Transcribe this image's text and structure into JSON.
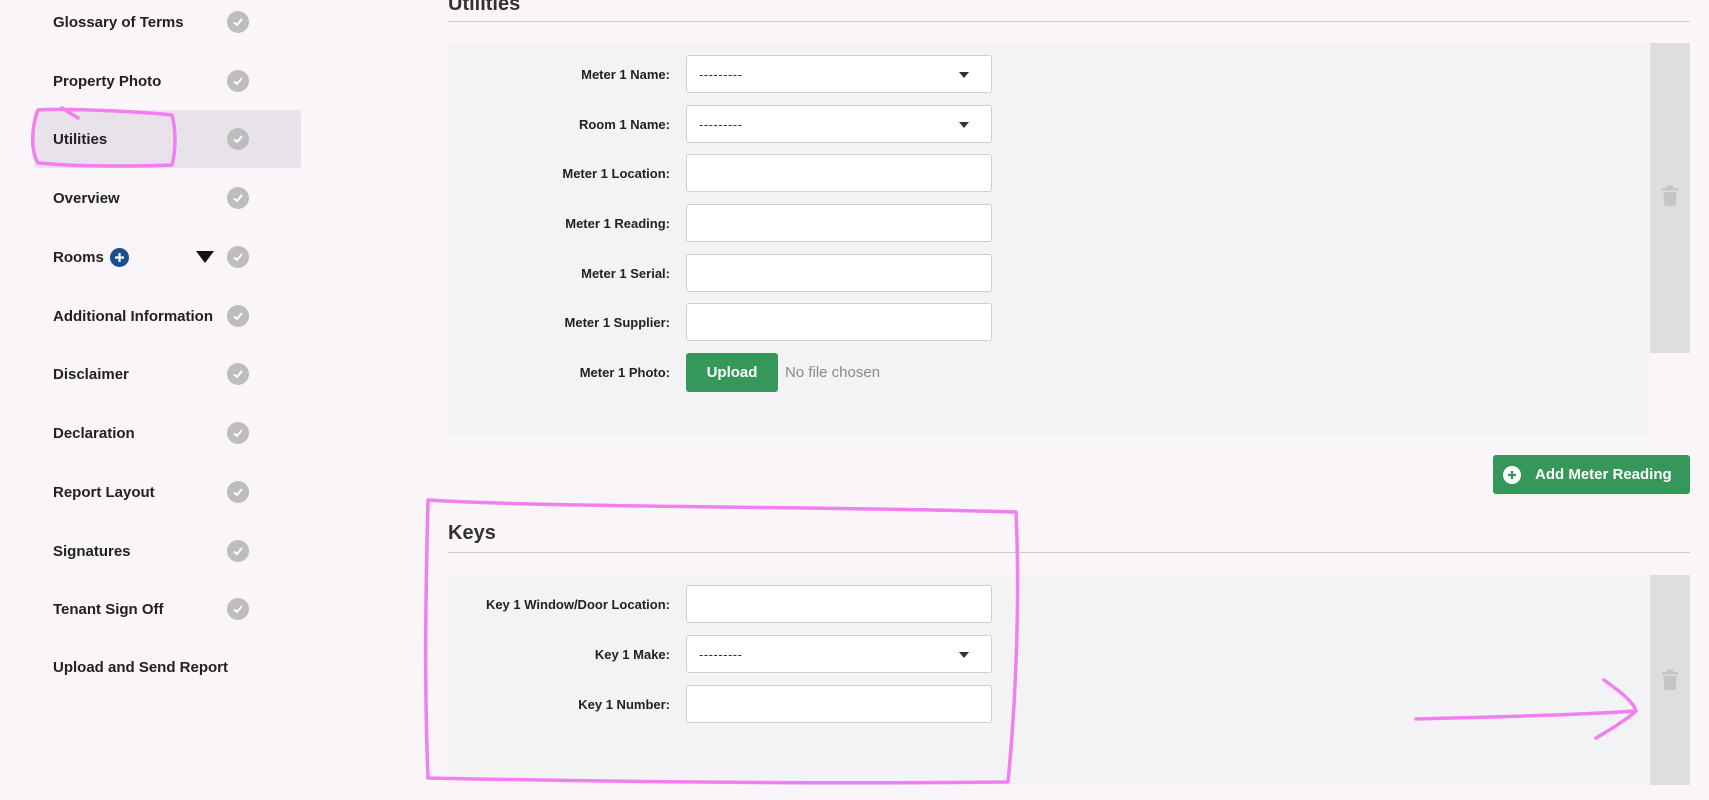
{
  "sidebar": {
    "items": [
      {
        "label": "Glossary of Terms"
      },
      {
        "label": "Property Photo"
      },
      {
        "label": "Utilities"
      },
      {
        "label": "Overview"
      },
      {
        "label": "Rooms"
      },
      {
        "label": "Additional Information"
      },
      {
        "label": "Disclaimer"
      },
      {
        "label": "Declaration"
      },
      {
        "label": "Report Layout"
      },
      {
        "label": "Signatures"
      },
      {
        "label": "Tenant Sign Off"
      },
      {
        "label": "Upload and Send Report"
      }
    ],
    "active_item": "Utilities"
  },
  "utilities": {
    "title": "Utilities",
    "fields": {
      "meter_name": {
        "label": "Meter 1 Name:",
        "value": "---------"
      },
      "room_name": {
        "label": "Room 1 Name:",
        "value": "---------"
      },
      "meter_location": {
        "label": "Meter 1 Location:",
        "value": ""
      },
      "meter_reading": {
        "label": "Meter 1 Reading:",
        "value": ""
      },
      "meter_serial": {
        "label": "Meter 1 Serial:",
        "value": ""
      },
      "meter_supplier": {
        "label": "Meter 1 Supplier:",
        "value": ""
      },
      "meter_photo": {
        "label": "Meter 1 Photo:",
        "button": "Upload",
        "status": "No file chosen"
      }
    },
    "add_button": "Add Meter Reading"
  },
  "keys": {
    "title": "Keys",
    "fields": {
      "key_location": {
        "label": "Key 1 Window/Door Location:",
        "value": ""
      },
      "key_make": {
        "label": "Key 1 Make:",
        "value": "---------"
      },
      "key_number": {
        "label": "Key 1 Number:",
        "value": ""
      }
    }
  },
  "colors": {
    "accent_green": "#36975a",
    "annotation_pink": "#f27ff0",
    "plus_blue": "#1a4f8c"
  }
}
